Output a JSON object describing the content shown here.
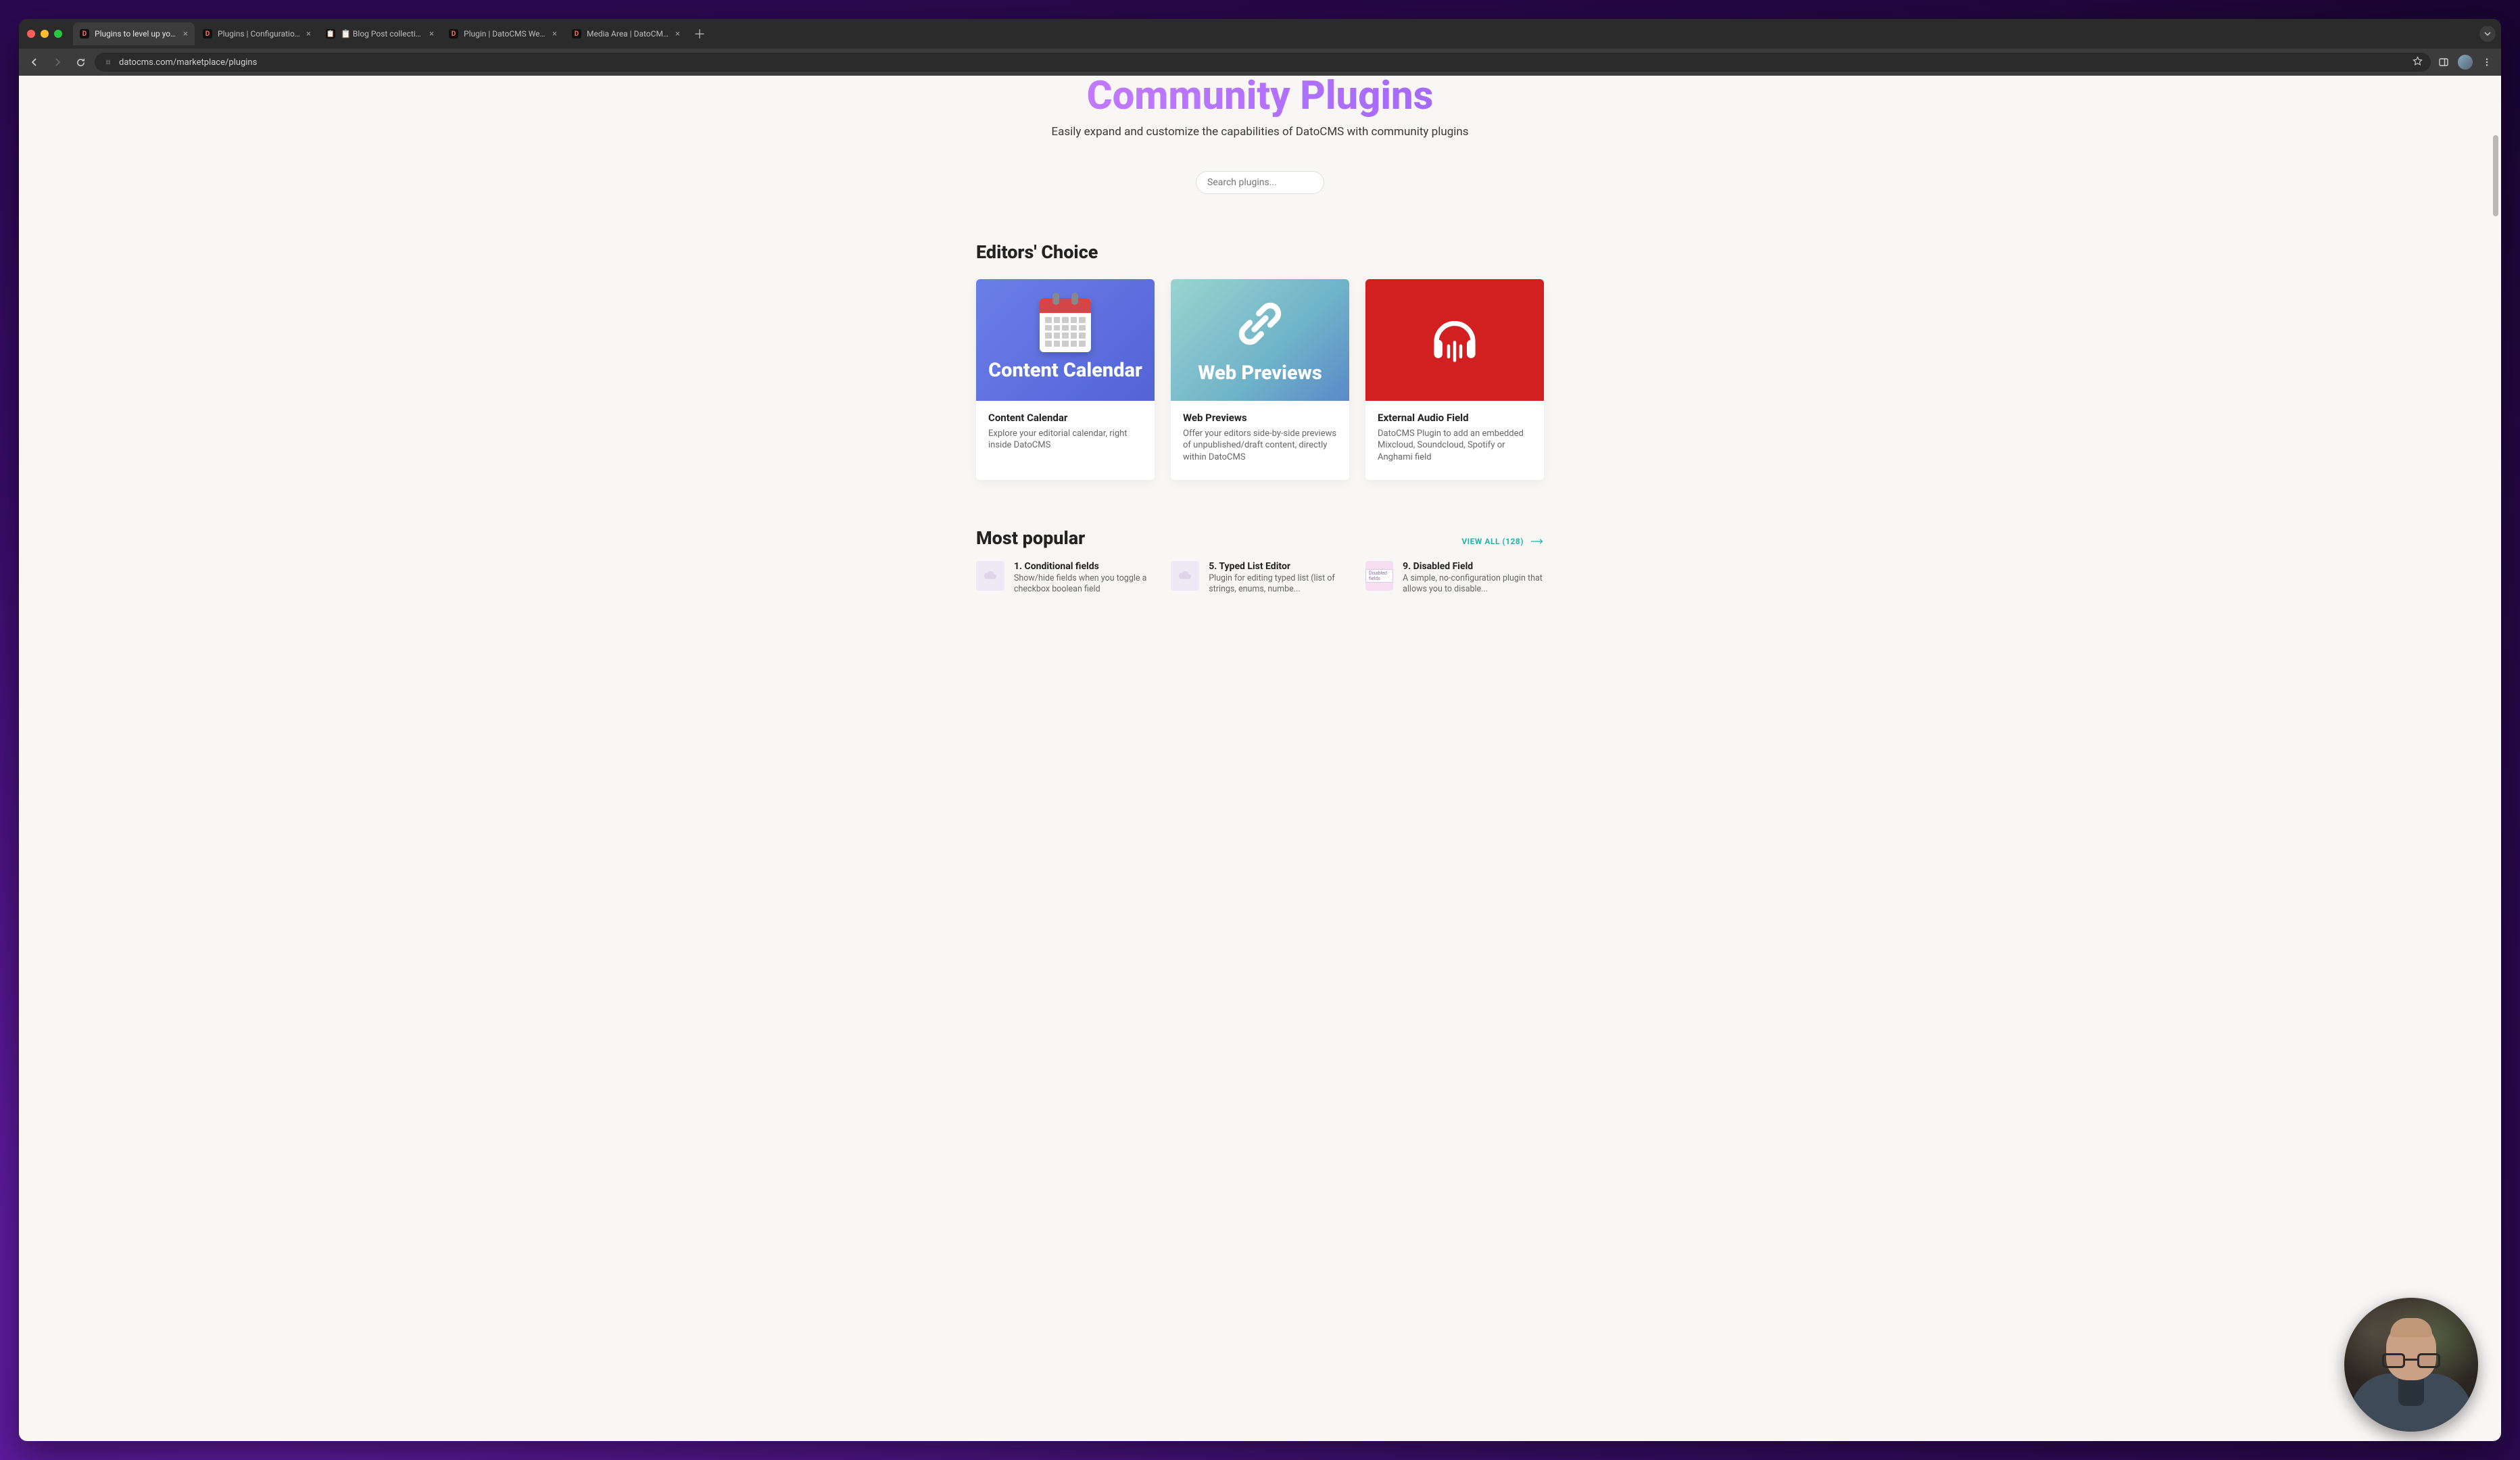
{
  "browser": {
    "tabs": [
      {
        "title": "Plugins to level up your Dato",
        "icon": "D"
      },
      {
        "title": "Plugins | Configuration | Dato",
        "icon": "D"
      },
      {
        "title": "📋 Blog Post collection | Con",
        "icon": "📋"
      },
      {
        "title": "Plugin | DatoCMS Website | D",
        "icon": "D"
      },
      {
        "title": "Media Area | DatoCMS Websi",
        "icon": "D"
      }
    ],
    "url": "datocms.com/marketplace/plugins"
  },
  "hero": {
    "title": "Community Plugins",
    "subtitle": "Easily expand and customize the capabilities of DatoCMS with community plugins"
  },
  "search": {
    "placeholder": "Search plugins..."
  },
  "sections": {
    "editors_choice": "Editors' Choice",
    "most_popular": "Most popular",
    "view_all": "VIEW ALL (128)"
  },
  "editors_cards": [
    {
      "hero_label": "Content Calendar",
      "title": "Content Calendar",
      "desc": "Explore your editorial calendar, right inside DatoCMS"
    },
    {
      "hero_label": "Web Previews",
      "title": "Web Previews",
      "desc": "Offer your editors side-by-side previews of unpublished/draft content, directly within DatoCMS"
    },
    {
      "hero_label": "",
      "title": "External Audio Field",
      "desc": "DatoCMS Plugin to add an embedded Mixcloud, Soundcloud, Spotify or Anghami field"
    }
  ],
  "popular": [
    {
      "title": "1. Conditional fields",
      "desc": "Show/hide fields when you toggle a checkbox boolean field"
    },
    {
      "title": "5. Typed List Editor",
      "desc": "Plugin for editing typed list (list of strings, enums, numbe..."
    },
    {
      "title": "9. Disabled Field",
      "desc": "A simple, no-configuration plugin that allows you to disable...",
      "badge": "Disabled fields"
    }
  ]
}
